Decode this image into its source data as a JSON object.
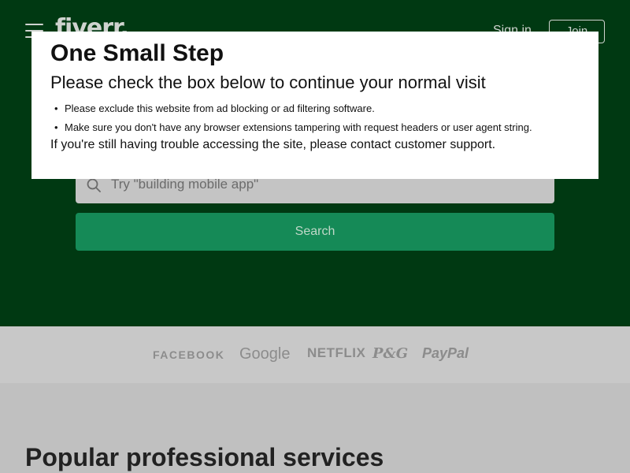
{
  "header": {
    "logo": "fiverr.",
    "signin_label": "Sign in",
    "join_label": "Join"
  },
  "search": {
    "placeholder": "Try \"building mobile app\"",
    "button_label": "Search"
  },
  "trusted_by": [
    "FACEBOOK",
    "Google",
    "NETFLIX",
    "P&G",
    "PayPal"
  ],
  "services": {
    "title": "Popular professional services"
  },
  "modal": {
    "title": "One Small Step",
    "subtitle": "Please check the box below to continue your normal visit",
    "bullets": [
      "Please exclude this website from ad blocking or ad filtering software.",
      "Make sure you don't have any browser extensions tampering with request headers or user agent string."
    ],
    "footer": "If you're still having trouble accessing the site, please contact customer support."
  },
  "colors": {
    "hero_bg": "#003912",
    "search_button": "#158a57",
    "modal_bg": "#ffffff"
  }
}
